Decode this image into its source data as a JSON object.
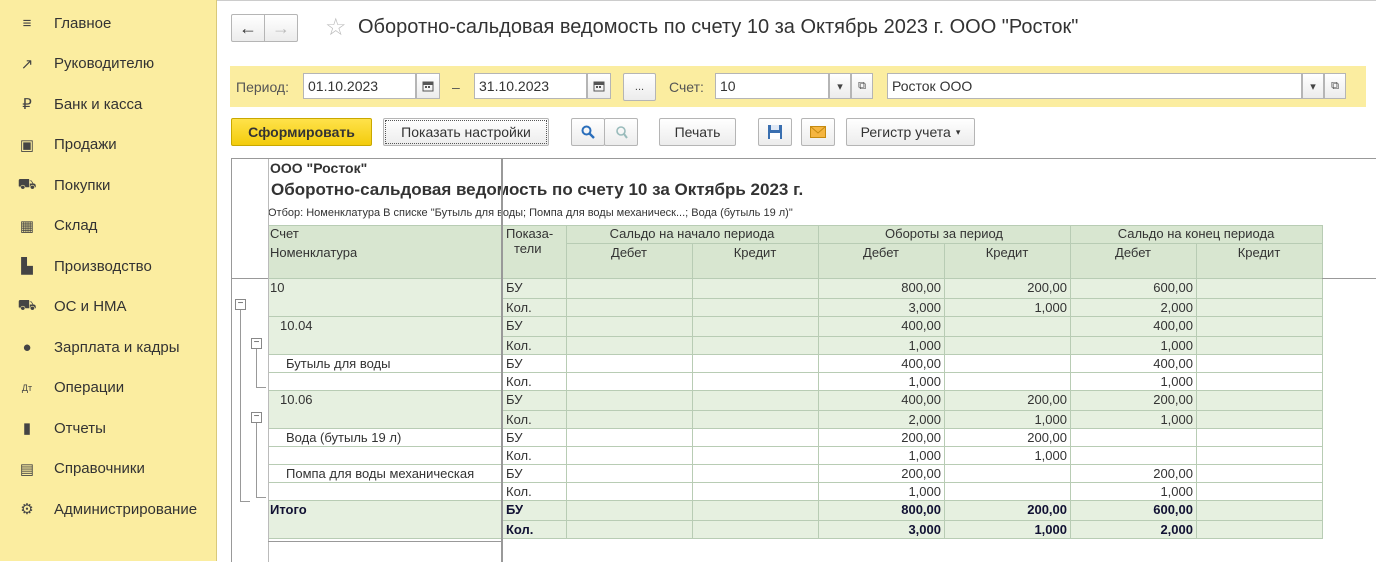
{
  "sidebar": {
    "items": [
      {
        "label": "Главное",
        "icon": "menu-icon"
      },
      {
        "label": "Руководителю",
        "icon": "trend-icon"
      },
      {
        "label": "Банк и касса",
        "icon": "ruble-coin-icon"
      },
      {
        "label": "Продажи",
        "icon": "shopping-bag-icon"
      },
      {
        "label": "Покупки",
        "icon": "cart-icon"
      },
      {
        "label": "Склад",
        "icon": "warehouse-icon"
      },
      {
        "label": "Производство",
        "icon": "factory-icon"
      },
      {
        "label": "ОС и НМА",
        "icon": "truck-icon"
      },
      {
        "label": "Зарплата и кадры",
        "icon": "person-icon"
      },
      {
        "label": "Операции",
        "icon": "dt-kt-icon"
      },
      {
        "label": "Отчеты",
        "icon": "bar-chart-icon"
      },
      {
        "label": "Справочники",
        "icon": "books-icon"
      },
      {
        "label": "Администрирование",
        "icon": "gear-icon"
      }
    ]
  },
  "header": {
    "back": "←",
    "forward": "→",
    "star": "☆",
    "title": "Оборотно-сальдовая ведомость по счету 10 за Октябрь 2023 г. ООО \"Росток\""
  },
  "filters": {
    "period_label": "Период:",
    "date_from": "01.10.2023",
    "dash": "–",
    "date_to": "31.10.2023",
    "ellipsis": "...",
    "account_label": "Счет:",
    "account_value": "10",
    "org_value": "Росток ООО"
  },
  "toolbar": {
    "generate": "Сформировать",
    "show_settings": "Показать настройки",
    "print": "Печать",
    "register": "Регистр учета"
  },
  "report": {
    "org": "ООО \"Росток\"",
    "title": "Оборотно-сальдовая ведомость по счету 10 за Октябрь 2023 г.",
    "filter_text": "Отбор: Номенклатура В списке \"Бутыль для воды; Помпа для воды механическ...; Вода (бутыль 19 л)\"",
    "headers": {
      "account": "Счет",
      "nomenclature": "Номенклатура",
      "indicators_1": "Показа-",
      "indicators_2": "тели",
      "opening": "Сальдо на начало периода",
      "turnover": "Обороты за период",
      "closing": "Сальдо на конец периода",
      "debit": "Дебет",
      "credit": "Кредит"
    },
    "rows": [
      {
        "name": "10",
        "indent": 0,
        "type": "БУ",
        "od": "",
        "oc": "",
        "td": "800,00",
        "tc": "200,00",
        "cd": "600,00",
        "cc": "",
        "shade": true
      },
      {
        "name": "",
        "indent": 0,
        "type": "Кол.",
        "od": "",
        "oc": "",
        "td": "3,000",
        "tc": "1,000",
        "cd": "2,000",
        "cc": "",
        "shade": true
      },
      {
        "name": "10.04",
        "indent": 1,
        "type": "БУ",
        "od": "",
        "oc": "",
        "td": "400,00",
        "tc": "",
        "cd": "400,00",
        "cc": "",
        "shade": true
      },
      {
        "name": "",
        "indent": 1,
        "type": "Кол.",
        "od": "",
        "oc": "",
        "td": "1,000",
        "tc": "",
        "cd": "1,000",
        "cc": "",
        "shade": true
      },
      {
        "name": "Бутыль для воды",
        "indent": 2,
        "type": "БУ",
        "od": "",
        "oc": "",
        "td": "400,00",
        "tc": "",
        "cd": "400,00",
        "cc": "",
        "shade": false
      },
      {
        "name": "",
        "indent": 2,
        "type": "Кол.",
        "od": "",
        "oc": "",
        "td": "1,000",
        "tc": "",
        "cd": "1,000",
        "cc": "",
        "shade": false
      },
      {
        "name": "10.06",
        "indent": 1,
        "type": "БУ",
        "od": "",
        "oc": "",
        "td": "400,00",
        "tc": "200,00",
        "cd": "200,00",
        "cc": "",
        "shade": true
      },
      {
        "name": "",
        "indent": 1,
        "type": "Кол.",
        "od": "",
        "oc": "",
        "td": "2,000",
        "tc": "1,000",
        "cd": "1,000",
        "cc": "",
        "shade": true
      },
      {
        "name": "Вода (бутыль 19 л)",
        "indent": 2,
        "type": "БУ",
        "od": "",
        "oc": "",
        "td": "200,00",
        "tc": "200,00",
        "cd": "",
        "cc": "",
        "shade": false
      },
      {
        "name": "",
        "indent": 2,
        "type": "Кол.",
        "od": "",
        "oc": "",
        "td": "1,000",
        "tc": "1,000",
        "cd": "",
        "cc": "",
        "shade": false
      },
      {
        "name": "Помпа для воды механическая",
        "indent": 2,
        "type": "БУ",
        "od": "",
        "oc": "",
        "td": "200,00",
        "tc": "",
        "cd": "200,00",
        "cc": "",
        "shade": false
      },
      {
        "name": "",
        "indent": 2,
        "type": "Кол.",
        "od": "",
        "oc": "",
        "td": "1,000",
        "tc": "",
        "cd": "1,000",
        "cc": "",
        "shade": false
      },
      {
        "name": "Итого",
        "indent": 0,
        "type": "БУ",
        "od": "",
        "oc": "",
        "td": "800,00",
        "tc": "200,00",
        "cd": "600,00",
        "cc": "",
        "shade": true,
        "bold": true
      },
      {
        "name": "",
        "indent": 0,
        "type": "Кол.",
        "od": "",
        "oc": "",
        "td": "3,000",
        "tc": "1,000",
        "cd": "2,000",
        "cc": "",
        "shade": true,
        "bold": true
      }
    ],
    "colors": {
      "shade": "#e6f0e0",
      "header": "#d8e6d0",
      "grid": "#b8ccb4"
    }
  }
}
